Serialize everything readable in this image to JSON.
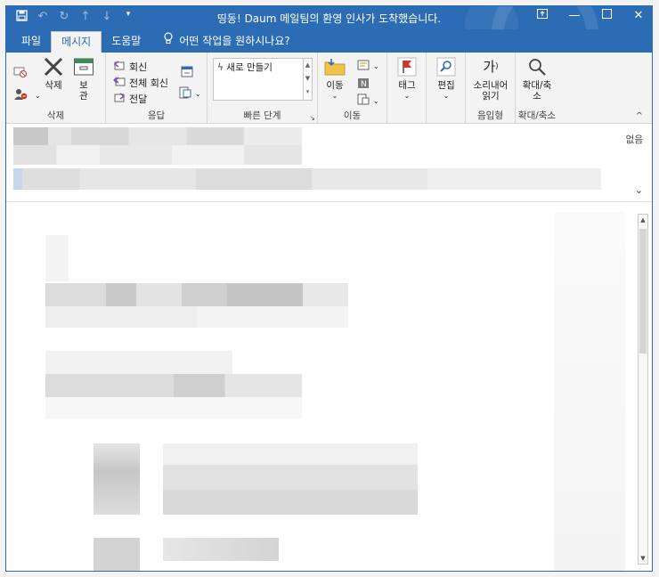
{
  "window": {
    "title": "띵동! Daum 메일팀의 환영 인사가 도착했습니다."
  },
  "tabs": [
    "파일",
    "메시지",
    "도움말"
  ],
  "active_tab": "메시지",
  "tell_me": "어떤 작업을 원하시나요?",
  "ribbon": {
    "delete_group": {
      "label": "삭제",
      "delete": "삭제",
      "archive": "보관"
    },
    "respond_group": {
      "label": "응답",
      "reply": "회신",
      "reply_all": "전체 회신",
      "forward": "전달"
    },
    "quick_steps": {
      "label": "빠른 단계",
      "new_item": "새로 만들기"
    },
    "move_group": {
      "label": "이동",
      "move": "이동"
    },
    "tags_group": {
      "label": "",
      "tags": "태그"
    },
    "edit_group": {
      "label": "",
      "edit": "편집"
    },
    "speech_group": {
      "label": "음입형",
      "read_aloud": "소리내어 읽기",
      "glyph": "가"
    },
    "zoom_group": {
      "label": "확대/축소",
      "zoom": "확대/축소"
    }
  },
  "header": {
    "zoom_state": "없음"
  },
  "colors": {
    "title_bar": "#2b6cb5",
    "ribbon_bg": "#f3f3f3"
  }
}
